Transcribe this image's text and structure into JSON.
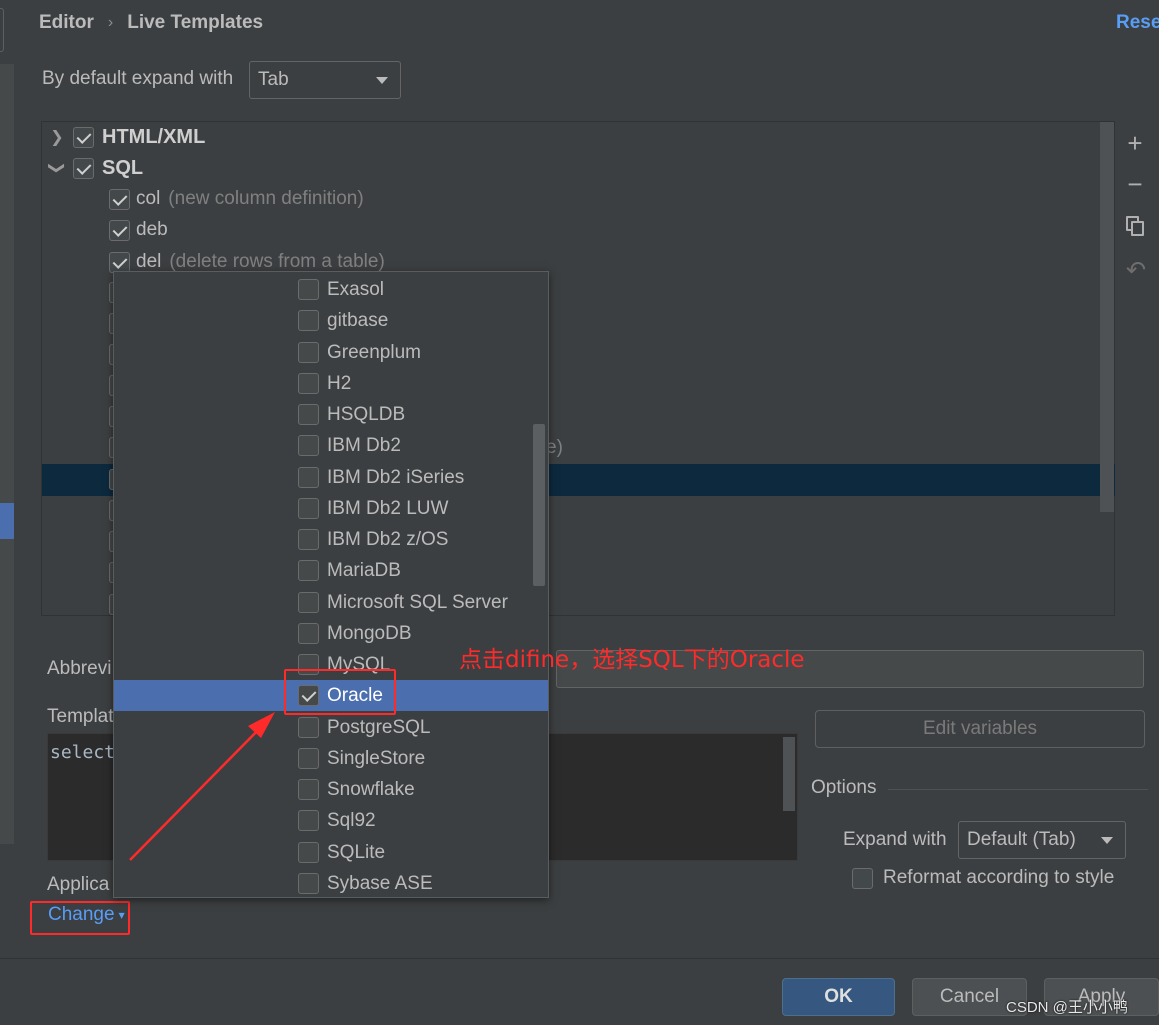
{
  "header": {
    "breadcrumb": [
      "Editor",
      "Live Templates"
    ],
    "reset_label": "Reset"
  },
  "expand": {
    "label": "By default expand with",
    "value": "Tab"
  },
  "tree": {
    "groups": [
      {
        "label": "HTML/XML",
        "checked": true,
        "expanded": false
      },
      {
        "label": "SQL",
        "checked": true,
        "expanded": true
      }
    ],
    "templates": [
      {
        "abbr": "col",
        "desc": "(new column definition)",
        "checked": true
      },
      {
        "abbr": "deb",
        "desc": "",
        "checked": true
      },
      {
        "abbr": "del",
        "desc": "(delete rows from a table)",
        "checked": true
      }
    ],
    "partial_text": "e)"
  },
  "toolbar": {
    "add_icon": "plus-icon",
    "remove_icon": "minus-icon",
    "copy_icon": "copy-icon",
    "restore_icon": "undo-icon"
  },
  "form": {
    "abbreviation_label": "Abbrevi",
    "template_label": "Templat",
    "template_text": "select",
    "applicable_label": "Applica",
    "change_label": "Change",
    "edit_variables_label": "Edit variables",
    "options_title": "Options",
    "expand_with_label": "Expand with",
    "expand_with_value": "Default (Tab)",
    "reformat_label": "Reformat according to style",
    "reformat_checked": false
  },
  "popup": {
    "items": [
      {
        "label": "Exasol",
        "checked": false
      },
      {
        "label": "gitbase",
        "checked": false
      },
      {
        "label": "Greenplum",
        "checked": false
      },
      {
        "label": "H2",
        "checked": false
      },
      {
        "label": "HSQLDB",
        "checked": false
      },
      {
        "label": "IBM Db2",
        "checked": false
      },
      {
        "label": "IBM Db2 iSeries",
        "checked": false
      },
      {
        "label": "IBM Db2 LUW",
        "checked": false
      },
      {
        "label": "IBM Db2 z/OS",
        "checked": false
      },
      {
        "label": "MariaDB",
        "checked": false
      },
      {
        "label": "Microsoft SQL Server",
        "checked": false
      },
      {
        "label": "MongoDB",
        "checked": false
      },
      {
        "label": "MySQL",
        "checked": false
      },
      {
        "label": "Oracle",
        "checked": true,
        "selected": true
      },
      {
        "label": "PostgreSQL",
        "checked": false
      },
      {
        "label": "SingleStore",
        "checked": false
      },
      {
        "label": "Snowflake",
        "checked": false
      },
      {
        "label": "Sql92",
        "checked": false
      },
      {
        "label": "SQLite",
        "checked": false
      },
      {
        "label": "Sybase ASE",
        "checked": false
      }
    ]
  },
  "annotation": {
    "text": "点击difine，选择SQL下的Oracle",
    "color": "#ff2a2a"
  },
  "footer": {
    "ok_label": "OK",
    "cancel_label": "Cancel",
    "apply_label": "Apply",
    "watermark": "CSDN @王小小鸭"
  },
  "colors": {
    "background": "#3c3f41",
    "accent": "#589df6",
    "selection": "#4b6eaf",
    "tree_selection": "#0d293e"
  }
}
